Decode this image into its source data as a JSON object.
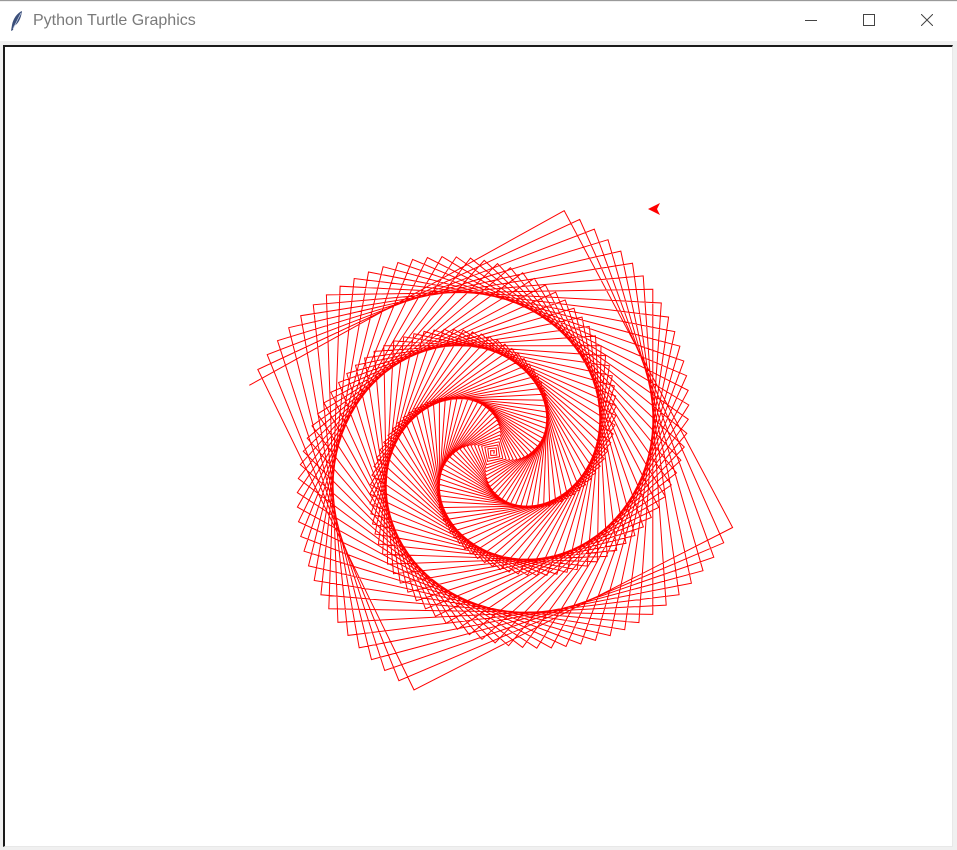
{
  "window": {
    "title": "Python Turtle Graphics",
    "app_icon": "feather-icon",
    "controls": [
      "minimize-icon",
      "maximize-icon",
      "close-icon"
    ]
  },
  "canvas": {
    "background": "#ffffff",
    "pen_color": "#ff0000",
    "turtle_shape": "arrow"
  }
}
